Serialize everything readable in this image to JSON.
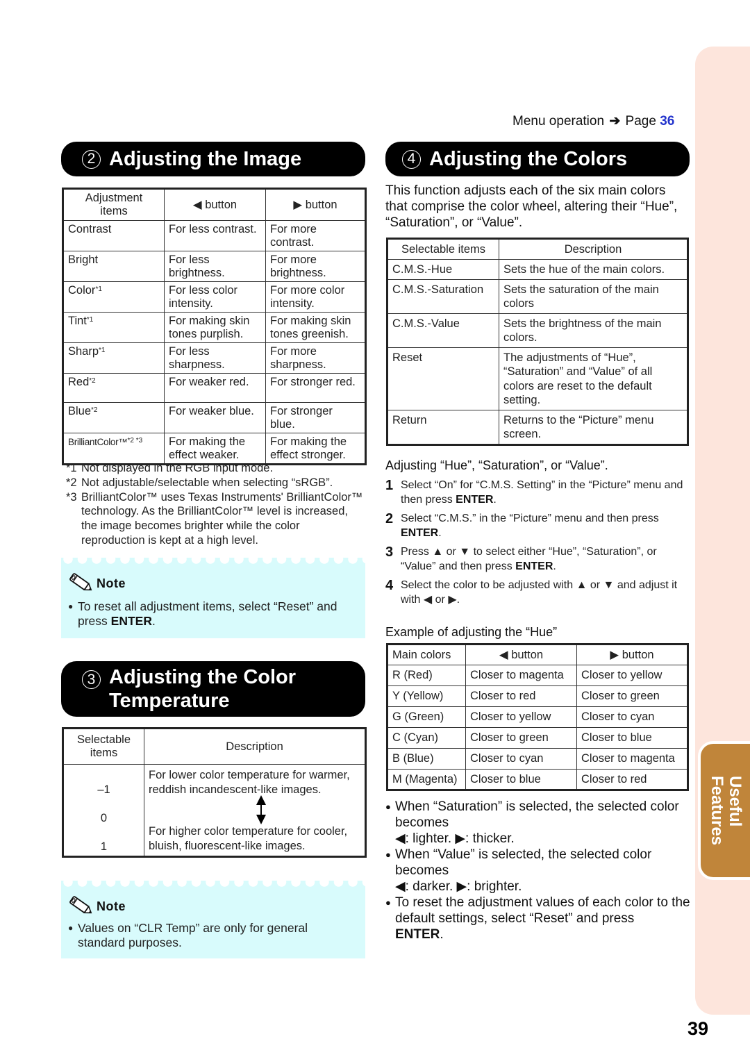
{
  "header": {
    "menu_operation": "Menu operation",
    "arrow": "➔",
    "page_prefix": "Page",
    "page_ref": "36"
  },
  "side_tab": {
    "line1": "Useful",
    "line2": "Features"
  },
  "page_number": "39",
  "colors": {
    "header_bg": "#000000",
    "note_bg": "#d8fbfc",
    "side_strip": "#fde5dc",
    "side_tab": "#c0853a",
    "page_link": "#2233cc"
  },
  "section_image": {
    "number": "2",
    "title": "Adjusting the Image",
    "table": {
      "headers": [
        "Adjustment items",
        "◀ button",
        "▶ button"
      ],
      "rows": [
        {
          "item": "Contrast",
          "sup": "",
          "left": "For less contrast.",
          "right": "For more contrast."
        },
        {
          "item": "Bright",
          "sup": "",
          "left": "For less brightness.",
          "right": "For more brightness."
        },
        {
          "item": "Color",
          "sup": "*1",
          "left": "For less color intensity.",
          "right": "For more color intensity."
        },
        {
          "item": "Tint",
          "sup": "*1",
          "left": "For making skin tones purplish.",
          "right": "For making skin tones greenish."
        },
        {
          "item": "Sharp",
          "sup": "*1",
          "left": "For less sharpness.",
          "right": "For more sharpness."
        },
        {
          "item": "Red",
          "sup": "*2",
          "left": "For weaker red.",
          "right": "For stronger red."
        },
        {
          "item": "Blue",
          "sup": "*2",
          "left": "For weaker blue.",
          "right": "For stronger blue."
        },
        {
          "item": "BrilliantColor™",
          "sup": "*2 *3",
          "left": "For making the effect weaker.",
          "right": "For making the effect stronger."
        }
      ]
    },
    "footnotes": [
      {
        "key": "*1",
        "text": "Not displayed in the RGB input mode."
      },
      {
        "key": "*2",
        "text": "Not adjustable/selectable when selecting “sRGB”."
      },
      {
        "key": "*3",
        "text": "BrilliantColor™ uses Texas Instruments' BrilliantColor™ technology. As the BrilliantColor™ level is increased, the image becomes brighter while the color reproduction is kept at a high level."
      }
    ],
    "note": {
      "title": "Note",
      "text_before": "To reset all adjustment items, select “Reset” and press ",
      "key": "ENTER",
      "text_after": "."
    }
  },
  "section_temp": {
    "number": "3",
    "title_line1": "Adjusting the Color",
    "title_line2": "Temperature",
    "table": {
      "headers": [
        "Selectable items",
        "Description"
      ],
      "values": [
        "–1",
        "0",
        "1"
      ],
      "desc_top": "For lower color temperature for warmer, reddish incandescent-like images.",
      "desc_bottom": "For higher color temperature for cooler, bluish, fluorescent-like images."
    },
    "note": {
      "title": "Note",
      "text": "Values on “CLR Temp” are only for general standard purposes."
    }
  },
  "section_colors": {
    "number": "4",
    "title": "Adjusting the Colors",
    "intro": "This function adjusts each of the six main colors that comprise the color wheel, altering their “Hue”, “Saturation”, or “Value”.",
    "table": {
      "headers": [
        "Selectable items",
        "Description"
      ],
      "rows": [
        {
          "item": "C.M.S.-Hue",
          "desc": "Sets the hue of the main colors."
        },
        {
          "item": "C.M.S.-Saturation",
          "desc": "Sets the saturation of the main colors"
        },
        {
          "item": "C.M.S.-Value",
          "desc": "Sets the brightness of the main colors."
        },
        {
          "item": "Reset",
          "desc": "The adjustments of “Hue”, “Saturation” and “Value” of all colors are reset to the default setting."
        },
        {
          "item": "Return",
          "desc": "Returns to the “Picture” menu screen."
        }
      ]
    },
    "steps_heading": "Adjusting “Hue”, “Saturation”, or “Value”.",
    "steps": [
      {
        "n": "1",
        "before": "Select “On” for “C.M.S. Setting” in the “Picture” menu and then press ",
        "key": "ENTER",
        "after": "."
      },
      {
        "n": "2",
        "before": "Select “C.M.S.” in the “Picture” menu and then press ",
        "key": "ENTER",
        "after": "."
      },
      {
        "n": "3",
        "before": "Press ▲ or ▼ to select either “Hue”, “Saturation”, or “Value” and then press ",
        "key": "ENTER",
        "after": "."
      },
      {
        "n": "4",
        "before": "Select the color to be adjusted with ▲ or ▼ and adjust it with ◀ or ▶.",
        "key": "",
        "after": ""
      }
    ],
    "example_heading": "Example of adjusting the “Hue”",
    "hue_table": {
      "headers": [
        "Main colors",
        "◀ button",
        "▶ button"
      ],
      "rows": [
        {
          "color": "R (Red)",
          "left": "Closer to magenta",
          "right": "Closer to yellow"
        },
        {
          "color": "Y (Yellow)",
          "left": "Closer to red",
          "right": "Closer to green"
        },
        {
          "color": "G (Green)",
          "left": "Closer to yellow",
          "right": "Closer to cyan"
        },
        {
          "color": "C (Cyan)",
          "left": "Closer to green",
          "right": "Closer to blue"
        },
        {
          "color": "B (Blue)",
          "left": "Closer to cyan",
          "right": "Closer to magenta"
        },
        {
          "color": "M (Magenta)",
          "left": "Closer to blue",
          "right": "Closer to red"
        }
      ]
    },
    "bullets": [
      {
        "text": "When “Saturation” is selected, the selected color becomes",
        "line": "◀: lighter.  ▶: thicker."
      },
      {
        "text": "When “Value” is selected, the selected color becomes",
        "line": "◀: darker.  ▶: brighter."
      },
      {
        "text": "To reset the adjustment values of each color to the default settings, select “Reset” and press",
        "key": "ENTER",
        "after": "."
      }
    ]
  }
}
